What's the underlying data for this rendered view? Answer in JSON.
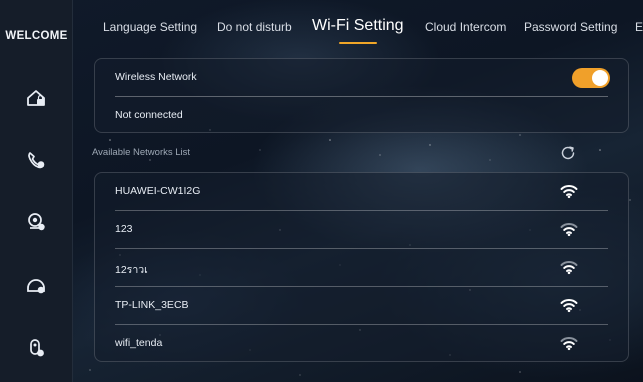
{
  "sidebar": {
    "brand": "WELCOME",
    "items": [
      {
        "icon": "home-lock-icon"
      },
      {
        "icon": "phone-call-icon"
      },
      {
        "icon": "camera-settings-icon"
      },
      {
        "icon": "intercom-edit-icon"
      },
      {
        "icon": "user-settings-icon"
      }
    ]
  },
  "tabs": [
    {
      "label": "Language Setting"
    },
    {
      "label": "Do not disturb"
    },
    {
      "label": "Wi-Fi Setting",
      "active": true
    },
    {
      "label": "Cloud Intercom"
    },
    {
      "label": "Password Setting"
    },
    {
      "label": "E"
    }
  ],
  "wireless": {
    "label": "Wireless Network",
    "enabled": true,
    "status": "Not connected"
  },
  "networks": {
    "section_label": "Available Networks List",
    "items": [
      {
        "name": "HUAWEI-CW1I2G"
      },
      {
        "name": "123"
      },
      {
        "name": "12ราวเ"
      },
      {
        "name": "TP-LINK_3ECB"
      },
      {
        "name": "wifi_tenda"
      }
    ]
  },
  "colors": {
    "accent": "#f0a628",
    "sidebar_bg": "#151d29",
    "text": "#e8edf4",
    "muted": "#9ea8b5"
  }
}
